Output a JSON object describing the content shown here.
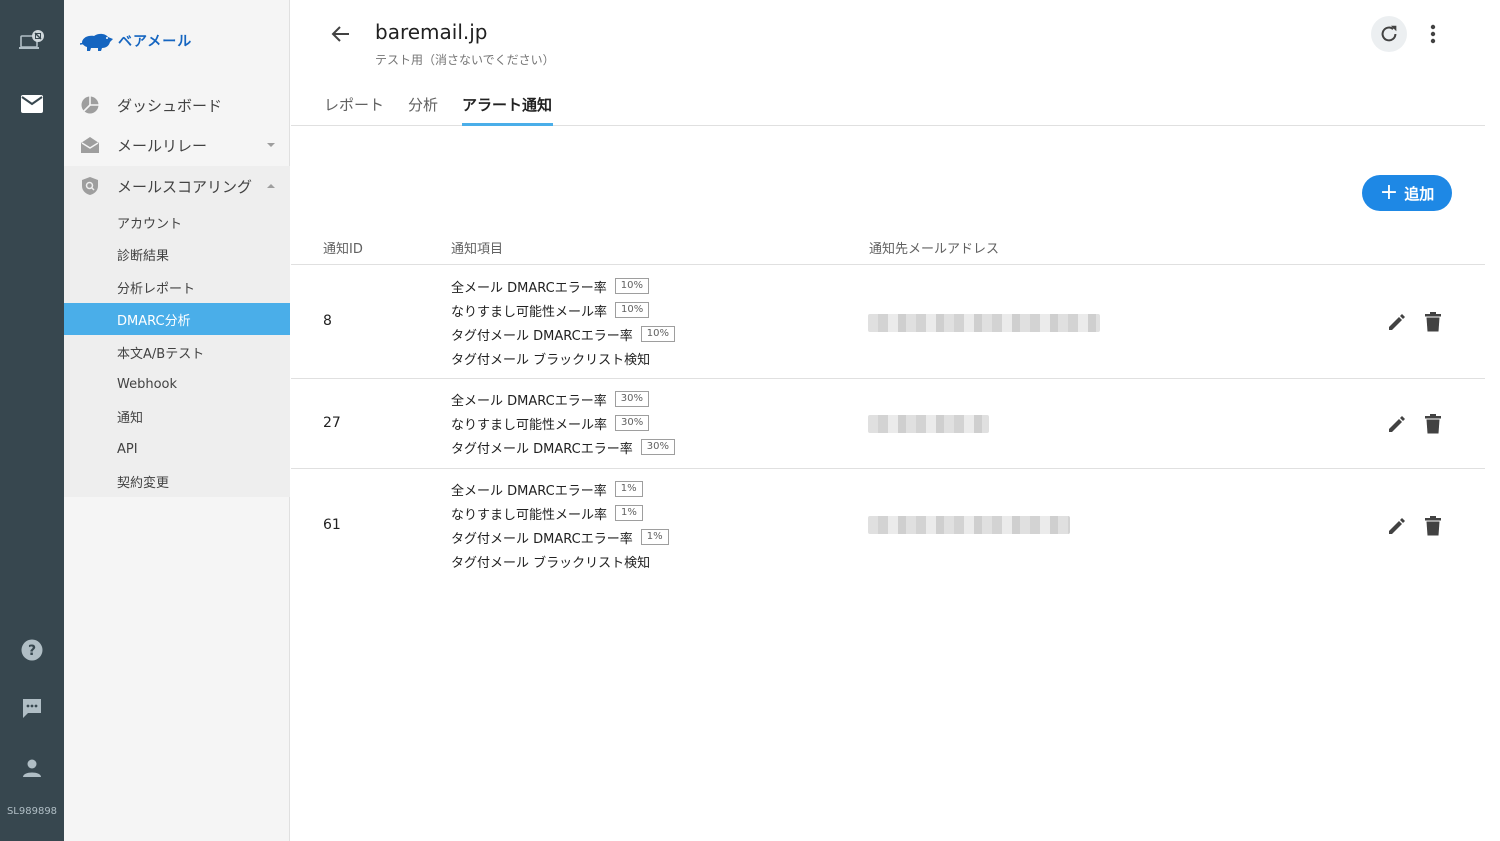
{
  "rail": {
    "user_id": "SL989898",
    "icons": [
      "devices-icon",
      "mail-icon",
      "help-icon",
      "chat-icon",
      "person-icon"
    ]
  },
  "sidebar": {
    "logo_text": "ベアメール",
    "nav": [
      {
        "label": "ダッシュボード",
        "icon": "dashboard-pie-icon"
      },
      {
        "label": "メールリレー",
        "icon": "mail-open-icon"
      },
      {
        "label": "メールスコアリング",
        "icon": "shield-search-icon"
      }
    ],
    "submenu": [
      "アカウント",
      "診断結果",
      "分析レポート",
      "DMARC分析",
      "本文A/Bテスト",
      "Webhook",
      "通知",
      "API",
      "契約変更"
    ],
    "active_submenu": "DMARC分析"
  },
  "header": {
    "title": "baremail.jp",
    "subtitle": "テスト用（消さないでください）"
  },
  "tabs": [
    {
      "label": "レポート",
      "active": false
    },
    {
      "label": "分析",
      "active": false
    },
    {
      "label": "アラート通知",
      "active": true
    }
  ],
  "add_button": {
    "label": "追加"
  },
  "table": {
    "headers": [
      "通知ID",
      "通知項目",
      "通知先メールアドレス"
    ],
    "rows": [
      {
        "id": "8",
        "items": [
          {
            "label": "全メール DMARCエラー率",
            "badge": "10%"
          },
          {
            "label": "なりすまし可能性メール率",
            "badge": "10%"
          },
          {
            "label": "タグ付メール DMARCエラー率",
            "badge": "10%"
          },
          {
            "label": "タグ付メール ブラックリスト検知",
            "badge": ""
          }
        ]
      },
      {
        "id": "27",
        "items": [
          {
            "label": "全メール DMARCエラー率",
            "badge": "30%"
          },
          {
            "label": "なりすまし可能性メール率",
            "badge": "30%"
          },
          {
            "label": "タグ付メール DMARCエラー率",
            "badge": "30%"
          }
        ]
      },
      {
        "id": "61",
        "items": [
          {
            "label": "全メール DMARCエラー率",
            "badge": "1%"
          },
          {
            "label": "なりすまし可能性メール率",
            "badge": "1%"
          },
          {
            "label": "タグ付メール DMARCエラー率",
            "badge": "1%"
          },
          {
            "label": "タグ付メール ブラックリスト検知",
            "badge": ""
          }
        ]
      }
    ]
  },
  "colors": {
    "rail": "#37474f",
    "accent": "#4aaee9",
    "button": "#1e88e5"
  }
}
